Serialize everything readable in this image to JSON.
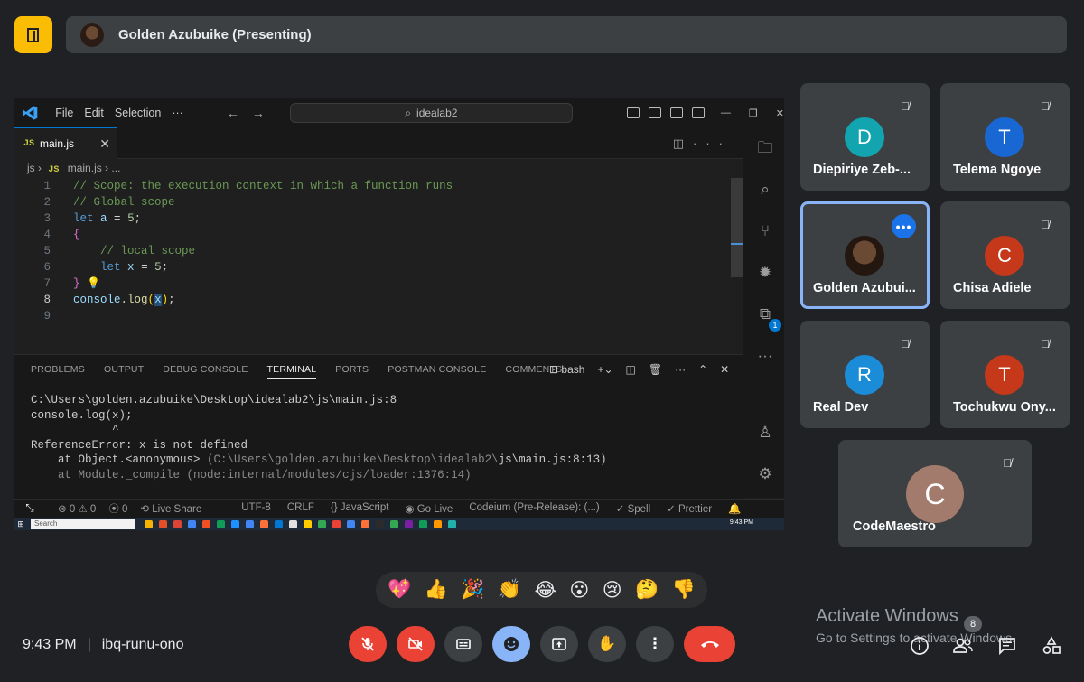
{
  "header": {
    "presenter_label": "Golden Azubuike (Presenting)",
    "door_icon": "door-icon"
  },
  "vscode": {
    "menu": [
      "File",
      "Edit",
      "Selection",
      "···"
    ],
    "command_center": "idealab2",
    "tab": {
      "badge": "JS",
      "label": "main.js",
      "close": "✕"
    },
    "breadcrumb": {
      "folder": "js",
      "badge": "JS",
      "file": "main.js",
      "rest": "..."
    },
    "code_lines": [
      {
        "n": "1",
        "text": "// Scope: the execution context in which a function runs"
      },
      {
        "n": "2",
        "text": "// Global scope"
      },
      {
        "n": "3",
        "text": "let a = 5;"
      },
      {
        "n": "4",
        "text": "{"
      },
      {
        "n": "5",
        "text": "    // local scope"
      },
      {
        "n": "6",
        "text": "    let x = 5;"
      },
      {
        "n": "7",
        "text": "}"
      },
      {
        "n": "8",
        "text": "console.log(x);"
      },
      {
        "n": "9",
        "text": ""
      }
    ],
    "activity_badge": "1",
    "panel_tabs": [
      "PROBLEMS",
      "OUTPUT",
      "DEBUG CONSOLE",
      "TERMINAL",
      "PORTS",
      "POSTMAN CONSOLE",
      "COMMENTS"
    ],
    "active_panel_tab": "TERMINAL",
    "shell": "bash",
    "terminal": {
      "l1": "C:\\Users\\golden.azubuike\\Desktop\\idealab2\\js\\main.js:8",
      "l2": "console.log(x);",
      "l3": "            ^",
      "l4": "",
      "l5": "ReferenceError: x is not defined",
      "l6a": "    at Object.<anonymous> ",
      "l6b": "(C:\\Users\\golden.azubuike\\Desktop\\idealab2\\",
      "l6c": "js\\main.js:8:13)",
      "l7": "    at Module._compile (node:internal/modules/cjs/loader:1376:14)"
    },
    "status": {
      "errors": "⊗ 0 ⚠ 0",
      "ports": "⦿ 0",
      "live_share": "Live Share",
      "encoding": "UTF-8",
      "eol": "CRLF",
      "language": "{} JavaScript",
      "go_live": "Go Live",
      "codeium": "Codeium (Pre-Release): (...)",
      "spell": "✓ Spell",
      "prettier": "✓ Prettier"
    },
    "taskbar": {
      "search": "Search",
      "clock": "9:43 PM"
    }
  },
  "participants": [
    {
      "initial": "D",
      "name": "Diepiriye Zeb-...",
      "color": "#12a4af"
    },
    {
      "initial": "T",
      "name": "Telema Ngoye",
      "color": "#1967d2"
    },
    {
      "initial": "",
      "name": "Golden Azubui...",
      "color": "#2a1c14"
    },
    {
      "initial": "C",
      "name": "Chisa Adiele",
      "color": "#c5381a"
    },
    {
      "initial": "R",
      "name": "Real Dev",
      "color": "#1a8cd8"
    },
    {
      "initial": "T",
      "name": "Tochukwu Ony...",
      "color": "#c5381a"
    },
    {
      "initial": "C",
      "name": "CodeMaestro",
      "color": "#a37b6d"
    }
  ],
  "more_options": "•••",
  "reactions": [
    "💖",
    "👍",
    "🎉",
    "👏",
    "😂",
    "😮",
    "😢",
    "🤔",
    "👎"
  ],
  "meeting": {
    "time": "9:43 PM",
    "separator": "|",
    "code": "ibq-runu-ono"
  },
  "watermark": {
    "title": "Activate Windows",
    "subtitle": "Go to Settings to activate Windows."
  },
  "people_count": "8",
  "accent": {
    "red": "#ea4335",
    "blue": "#8ab4f8",
    "yellow": "#fbbc04"
  }
}
